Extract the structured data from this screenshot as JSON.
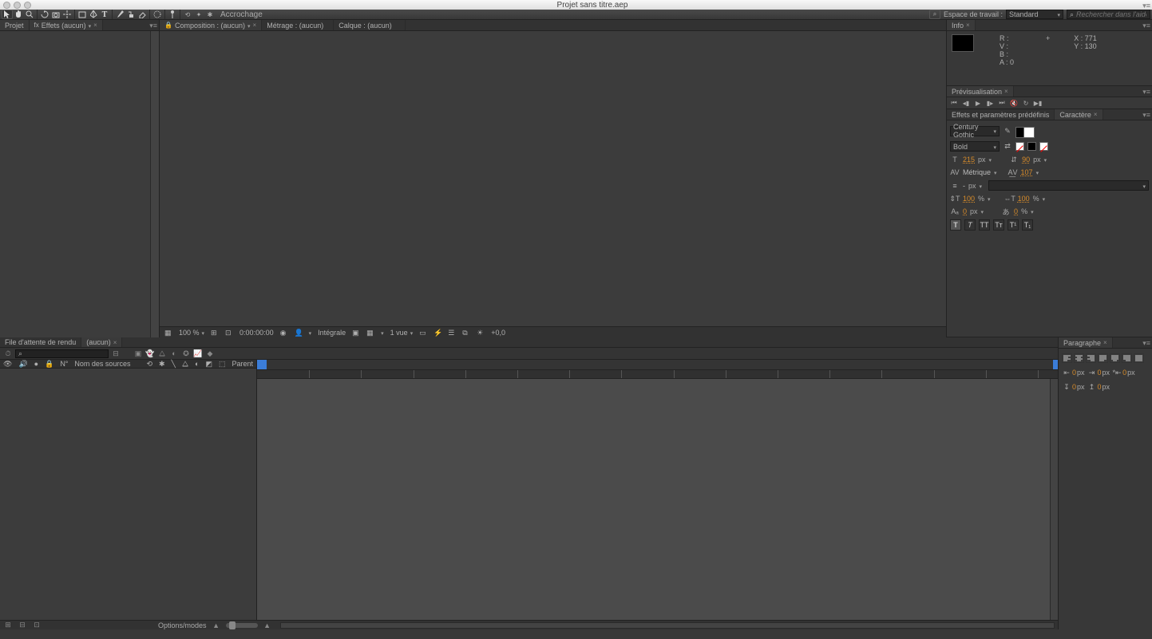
{
  "window_title": "Projet sans titre.aep",
  "toolbar_label": "Accrochage",
  "workspace_label": "Espace de travail :",
  "workspace_value": "Standard",
  "search_help_placeholder": "Rechercher dans l'aide",
  "project_tab": "Projet",
  "effects_tab": "Effets (aucun)",
  "comp_tab": "Composition : (aucun)",
  "metrage_tab": "Métrage : (aucun)",
  "calque_tab": "Calque : (aucun)",
  "viewer_footer": {
    "zoom": "100 %",
    "time": "0:00:00:00",
    "quality": "Intégrale",
    "view": "1 vue",
    "exposure": "+0,0"
  },
  "info": {
    "title": "Info",
    "R": "R :",
    "V": "V :",
    "B": "B :",
    "A": "A : 0",
    "X": "X : 771",
    "Y": "Y : 130"
  },
  "preview_title": "Prévisualisation",
  "effects_presets_tab": "Effets et paramètres prédéfinis",
  "char": {
    "title": "Caractère",
    "font": "Century Gothic",
    "style": "Bold",
    "size": "215",
    "size_unit": "px",
    "leading": "90",
    "leading_unit": "px",
    "kerning": "Métrique",
    "tracking": "107",
    "stroke_val": "-",
    "stroke_unit": "px",
    "vscale": "100",
    "hscale": "100",
    "pct": "%",
    "baseline": "0",
    "baseline_unit": "px",
    "tsume": "0",
    "tsume_unit": "%"
  },
  "render_queue_tab": "File d'attente de rendu",
  "tl_comp_tab": "(aucun)",
  "tl_columns": {
    "num": "N°",
    "name": "Nom des sources",
    "parent": "Parent"
  },
  "tl_options": "Options/modes",
  "para": {
    "title": "Paragraphe",
    "zero": "0",
    "unit": "px"
  }
}
